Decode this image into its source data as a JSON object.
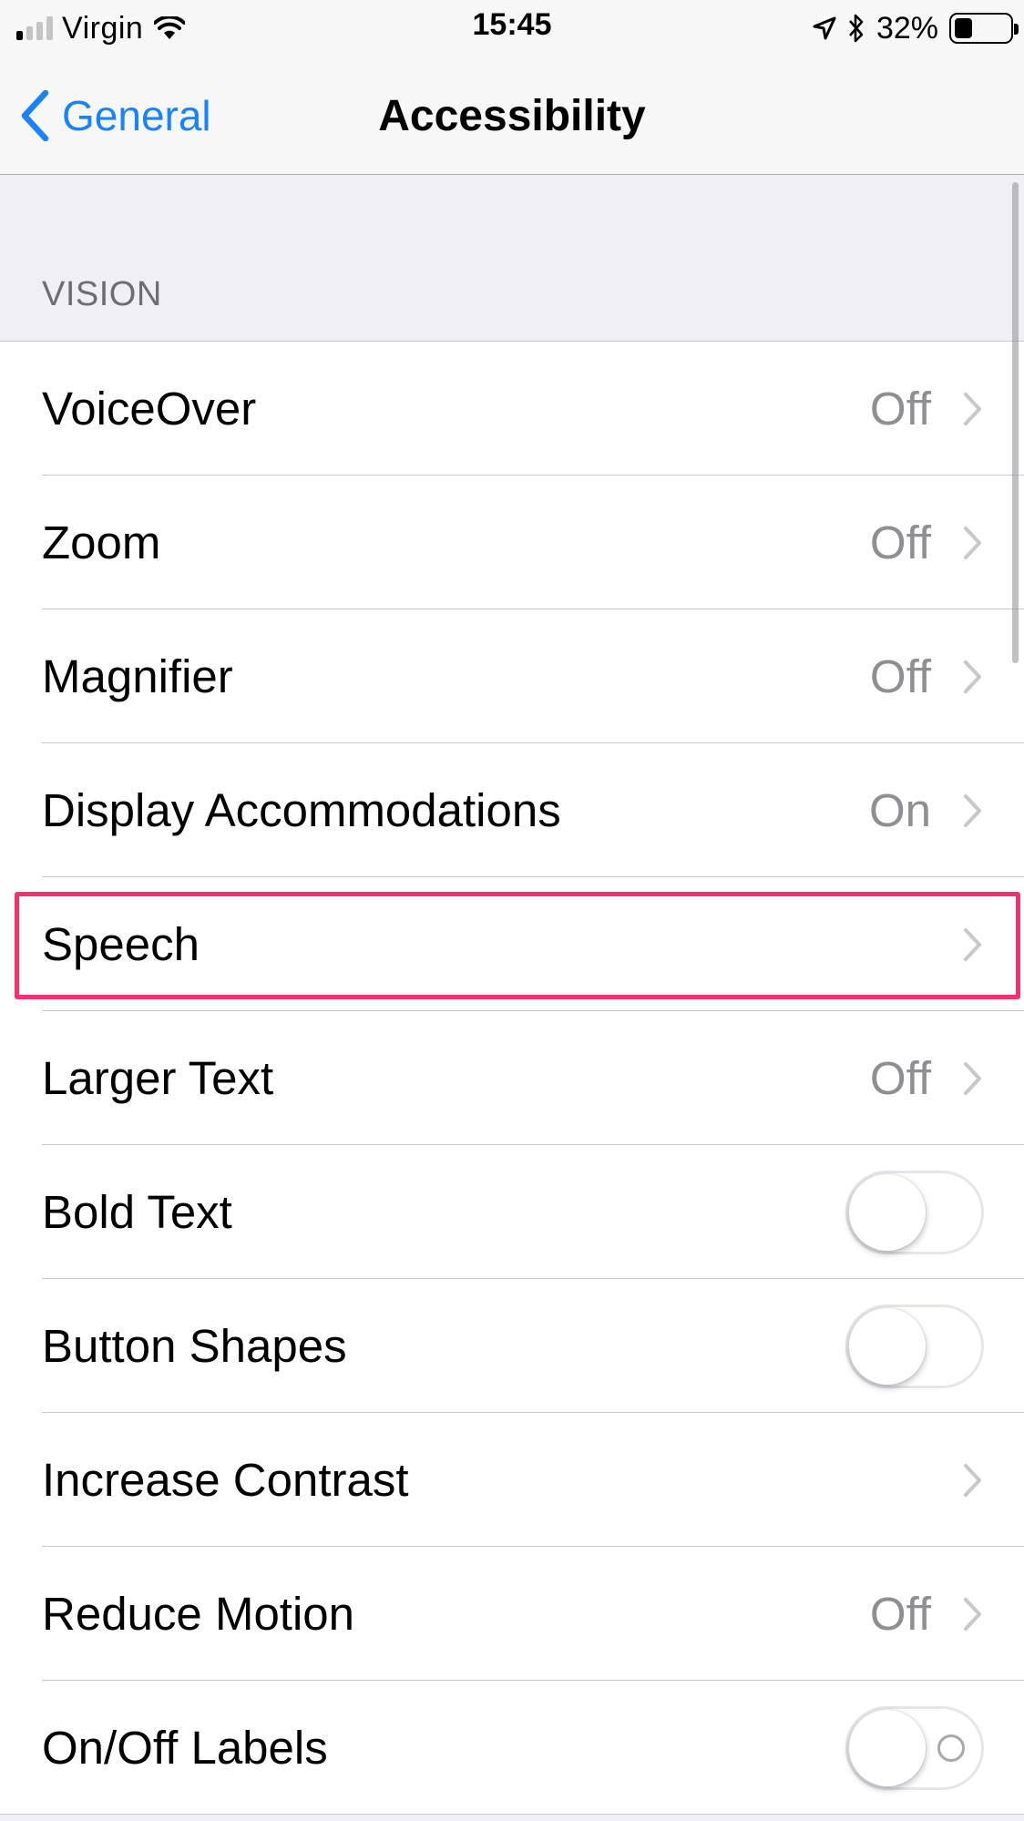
{
  "status_bar": {
    "carrier": "Virgin",
    "time": "15:45",
    "battery_percent": "32%",
    "battery_level": 0.32,
    "signal_bars_active": 1,
    "signal_bars_total": 4,
    "icons": [
      "signal-icon",
      "wifi-icon",
      "location-icon",
      "bluetooth-icon",
      "battery-icon"
    ]
  },
  "nav": {
    "back_label": "General",
    "title": "Accessibility"
  },
  "section": {
    "header": "VISION"
  },
  "rows": [
    {
      "label": "VoiceOver",
      "value": "Off",
      "accessory": "chevron"
    },
    {
      "label": "Zoom",
      "value": "Off",
      "accessory": "chevron"
    },
    {
      "label": "Magnifier",
      "value": "Off",
      "accessory": "chevron"
    },
    {
      "label": "Display Accommodations",
      "value": "On",
      "accessory": "chevron"
    },
    {
      "label": "Speech",
      "value": "",
      "accessory": "chevron",
      "highlighted": true
    },
    {
      "label": "Larger Text",
      "value": "Off",
      "accessory": "chevron"
    },
    {
      "label": "Bold Text",
      "accessory": "toggle",
      "on": false
    },
    {
      "label": "Button Shapes",
      "accessory": "toggle",
      "on": false
    },
    {
      "label": "Increase Contrast",
      "value": "",
      "accessory": "chevron"
    },
    {
      "label": "Reduce Motion",
      "value": "Off",
      "accessory": "chevron"
    },
    {
      "label": "On/Off Labels",
      "accessory": "toggle",
      "on": false,
      "show_off_label": true
    }
  ],
  "colors": {
    "accent": "#1a82fb",
    "highlight": "#f5306f",
    "secondary_text": "#8e8e93",
    "background": "#efeff4"
  }
}
